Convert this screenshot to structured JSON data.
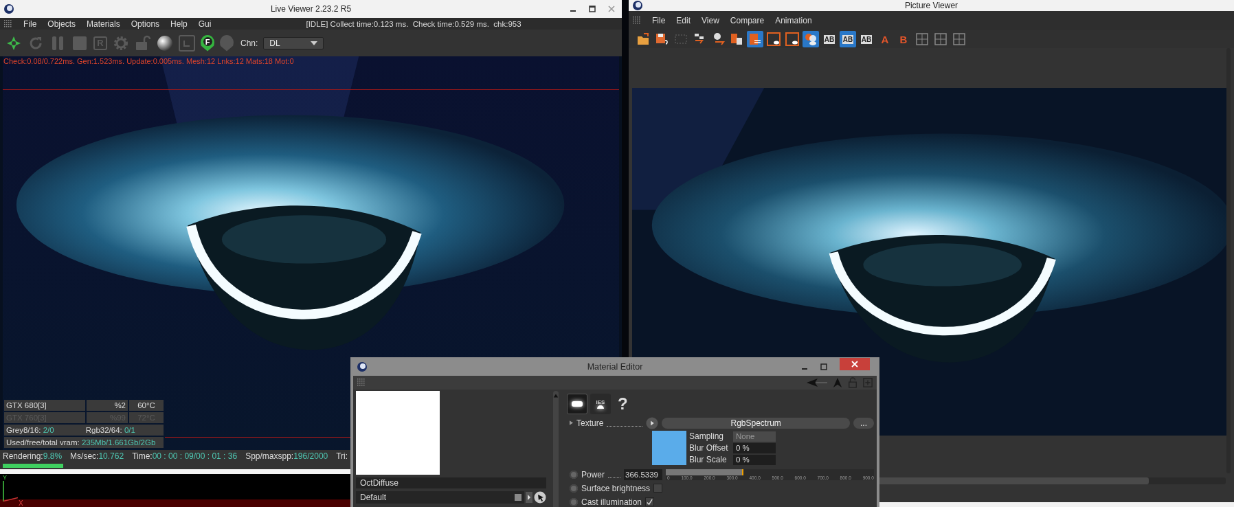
{
  "live_viewer": {
    "title": "Live Viewer 2.23.2 R5",
    "menu": [
      "File",
      "Objects",
      "Materials",
      "Options",
      "Help",
      "Gui"
    ],
    "status": "[IDLE] Collect time:0.123 ms.  Check time:0.529 ms.  chk:953",
    "toolbar": [
      {
        "kind": "logo",
        "enabled": true
      },
      {
        "kind": "refresh",
        "enabled": false
      },
      {
        "kind": "pause",
        "enabled": false
      },
      {
        "kind": "stop",
        "enabled": false
      },
      {
        "kind": "letter",
        "glyph": "R",
        "enabled": false
      },
      {
        "kind": "gear",
        "enabled": false
      },
      {
        "kind": "lock",
        "enabled": false
      },
      {
        "kind": "sphere",
        "enabled": true
      },
      {
        "kind": "frame",
        "enabled": false
      },
      {
        "kind": "pin",
        "glyph": "F",
        "enabled": true
      },
      {
        "kind": "pin",
        "enabled": false
      }
    ],
    "channel_label": "Chn:",
    "channel_value": "DL",
    "stats_line": "Check:0.08/0.722ms. Gen:1.523ms. Update:0.005ms. Mesh:12 Lnks:12 Mats:18 Mot:0",
    "gpus": [
      {
        "name": "GTX 680[3]",
        "usage": "%2",
        "temp": "60°C",
        "enabled": true
      },
      {
        "name": "GTX 760[3]",
        "usage": "%99",
        "temp": "72°C",
        "enabled": false
      }
    ],
    "textures": [
      {
        "label": "Grey8/16:",
        "value": "2/0"
      },
      {
        "label": "Rgb32/64:",
        "value": "0/1"
      }
    ],
    "vram": {
      "label": "Used/free/total vram:",
      "value": "235Mb/1.661Gb/2Gb"
    },
    "render_stats": [
      {
        "label": "Rendering:",
        "value": "9.8%"
      },
      {
        "label": "Ms/sec:",
        "value": "10.762"
      },
      {
        "label": "Time:",
        "value": "00 : 00 : 09/00 : 01 : 36"
      },
      {
        "label": "Spp/maxspp:",
        "value": "196/2000"
      },
      {
        "label": "Tri:"
      }
    ],
    "progress": {
      "level": 0.098
    },
    "axes": {
      "y": "Y",
      "x": "X"
    }
  },
  "picture_viewer": {
    "title": "Picture Viewer",
    "menu": [
      "File",
      "Edit",
      "View",
      "Compare",
      "Animation"
    ],
    "toolbar": [
      {
        "kind": "open",
        "selected": false
      },
      {
        "kind": "save",
        "selected": false
      },
      {
        "kind": "grid",
        "selected": false
      },
      {
        "kind": "export",
        "selected": false
      },
      {
        "kind": "person",
        "selected": false
      },
      {
        "kind": "delete",
        "selected": false
      },
      {
        "kind": "list",
        "selected": true
      },
      {
        "kind": "frame",
        "selected": false
      },
      {
        "kind": "frame",
        "selected": false
      },
      {
        "kind": "compare",
        "selected": true
      },
      {
        "kind": "ab",
        "glyph": "AB",
        "selected": false
      },
      {
        "kind": "ab",
        "glyph": "AB",
        "selected": true
      },
      {
        "kind": "ab",
        "glyph": "AB",
        "selected": false
      },
      {
        "kind": "letter",
        "glyph": "A",
        "selected": false
      },
      {
        "kind": "letter",
        "glyph": "B",
        "selected": false
      },
      {
        "kind": "split",
        "selected": false
      },
      {
        "kind": "split",
        "selected": false
      },
      {
        "kind": "split",
        "selected": false
      }
    ]
  },
  "material_editor": {
    "title": "Material Editor",
    "material_name": "OctDiffuse",
    "preset": "Default",
    "emission_tabs": [
      {
        "kind": "blackbody",
        "selected": true
      },
      {
        "kind": "ies",
        "glyph": "IES",
        "selected": false
      }
    ],
    "help": "?",
    "texture": {
      "label": "Texture",
      "value": "RgbSpectrum",
      "more": "...",
      "color": "#5aacea"
    },
    "texture_settings": [
      {
        "label": "Sampling",
        "value": "None",
        "disabled": true
      },
      {
        "label": "Blur Offset",
        "value": "0 %",
        "disabled": false
      },
      {
        "label": "Blur Scale",
        "value": "0 %",
        "disabled": false
      }
    ],
    "power": {
      "label": "Power",
      "value": "366.5339",
      "level": 0.3665,
      "ticks": [
        "0",
        "100.0",
        "200.0",
        "300.0",
        "400.0",
        "500.0",
        "600.0",
        "700.0",
        "800.0",
        "900.0"
      ]
    },
    "options": [
      {
        "label": "Surface brightness",
        "checked": false
      },
      {
        "label": "Cast illumination",
        "checked": true
      }
    ]
  }
}
